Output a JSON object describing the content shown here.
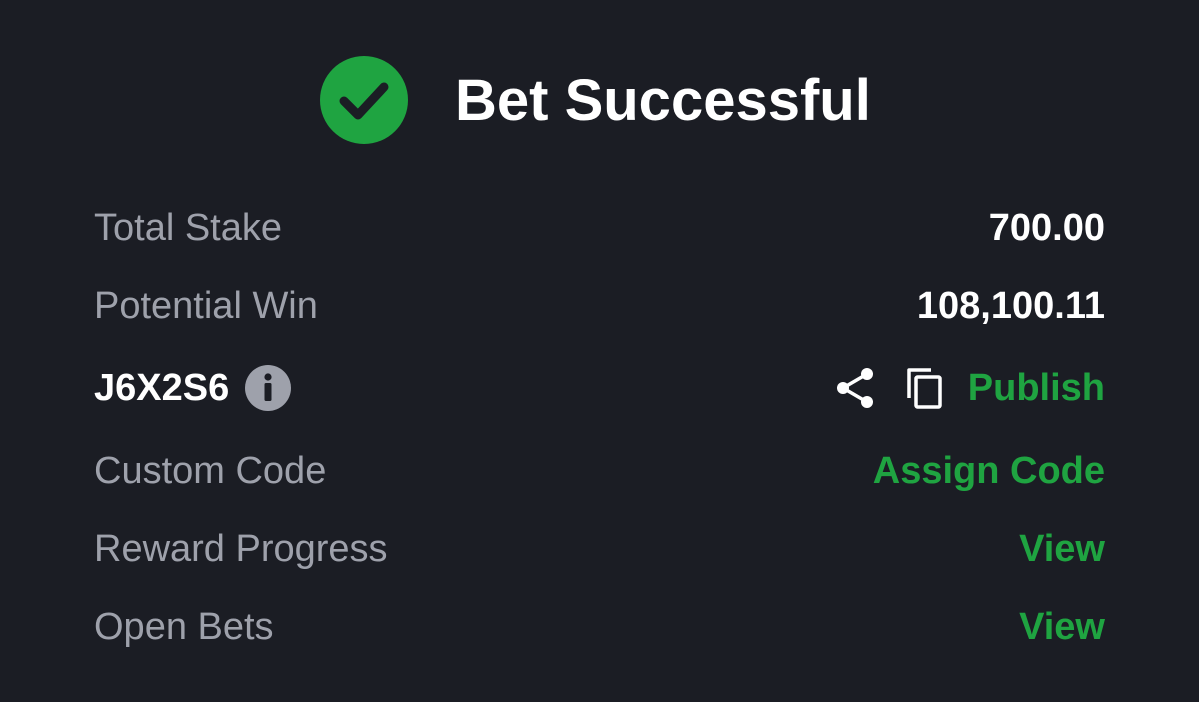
{
  "header": {
    "title": "Bet Successful",
    "icon": "check-circle-icon",
    "icon_color": "#1fa441"
  },
  "rows": {
    "total_stake": {
      "label": "Total Stake",
      "value": "700.00"
    },
    "potential_win": {
      "label": "Potential Win",
      "value": "108,100.11"
    },
    "booking": {
      "code": "J6X2S6",
      "info_icon": "info-icon",
      "share_icon": "share-icon",
      "copy_icon": "copy-icon",
      "publish_label": "Publish"
    },
    "custom_code": {
      "label": "Custom Code",
      "action": "Assign Code"
    },
    "reward_progress": {
      "label": "Reward Progress",
      "action": "View"
    },
    "open_bets": {
      "label": "Open Bets",
      "action": "View"
    }
  },
  "colors": {
    "background": "#1b1d24",
    "accent_green": "#1fa441",
    "label_gray": "#9ea1ab",
    "text_white": "#ffffff"
  }
}
